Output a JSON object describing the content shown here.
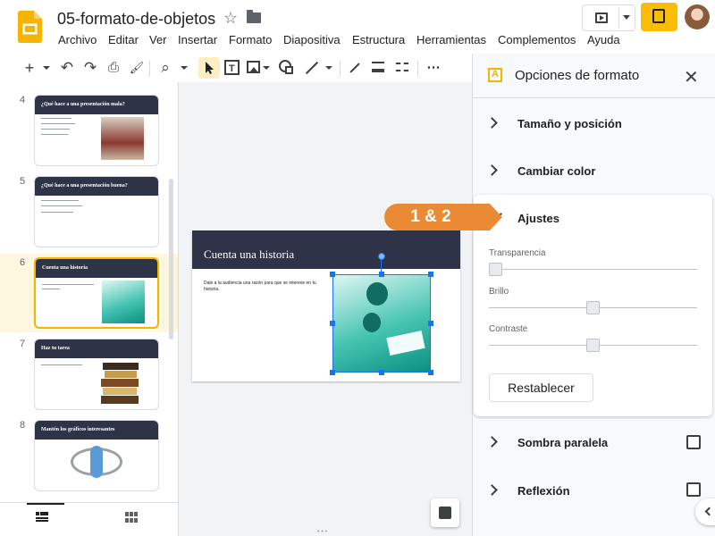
{
  "app": {
    "title": "05-formato-de-objetos",
    "menu": [
      "Archivo",
      "Editar",
      "Ver",
      "Insertar",
      "Formato",
      "Diapositiva",
      "Estructura",
      "Herramientas",
      "Complementos",
      "Ayuda"
    ]
  },
  "toolbar": {
    "add": "+",
    "undo": "↶",
    "redo": "↷",
    "print": "⎙",
    "paint": "🖌",
    "zoom": "⌕",
    "more": "⋯"
  },
  "filmstrip": {
    "slides": [
      {
        "num": "4",
        "title": "¿Qué hace a una presentación mala?"
      },
      {
        "num": "5",
        "title": "¿Qué hace a una presentación buena?"
      },
      {
        "num": "6",
        "title": "Cuenta una historia"
      },
      {
        "num": "7",
        "title": "Haz tu tarea"
      },
      {
        "num": "8",
        "title": "Mantén los gráficos interesantes"
      }
    ],
    "selected_slide": "6"
  },
  "slide": {
    "title": "Cuenta una historia",
    "body": "Dale a la audiencia una razón para que se interese en tu historia."
  },
  "panel": {
    "title": "Opciones de formato",
    "close": "✕",
    "sections": {
      "size": "Tamaño y posición",
      "recolor": "Cambiar color",
      "adjust": "Ajustes",
      "shadow": "Sombra paralela",
      "reflection": "Reflexión"
    },
    "sliders": {
      "transparency_label": "Transparencia",
      "transparency_value": 0,
      "brightness_label": "Brillo",
      "brightness_value": 0.5,
      "contrast_label": "Contraste",
      "contrast_value": 0.5
    },
    "reset": "Restablecer",
    "shadow_checked": false,
    "reflection_checked": false
  },
  "callout": {
    "text": "1 & 2",
    "color": "#ea8a35"
  },
  "colors": {
    "accent": "#f4b400",
    "selection": "#1a73e8",
    "slide_header": "#2e3347"
  }
}
